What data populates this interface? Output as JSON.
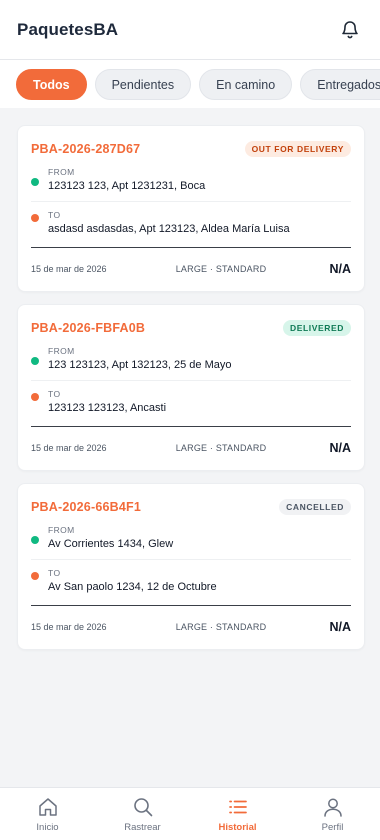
{
  "app": {
    "brand": "PaquetesBA"
  },
  "tabs": [
    {
      "label": "Todos",
      "active": true
    },
    {
      "label": "Pendientes",
      "active": false
    },
    {
      "label": "En camino",
      "active": false
    },
    {
      "label": "Entregados",
      "active": false
    }
  ],
  "shipments": [
    {
      "tracking": "PBA-2026-287D67",
      "status": "OUT FOR DELIVERY",
      "from_label": "FROM",
      "from": "123123 123, Apt 1231231, Boca",
      "to_label": "TO",
      "to": "asdasd asdasdas, Apt 123123, Aldea María Luisa",
      "date": "15 de mar de 2026",
      "size": "LARGE · STANDARD",
      "price": "N/A"
    },
    {
      "tracking": "PBA-2026-FBFA0B",
      "status": "DELIVERED",
      "from_label": "FROM",
      "from": "123 123123, Apt 132123, 25 de Mayo",
      "to_label": "TO",
      "to": "123123 123123, Ancasti",
      "date": "15 de mar de 2026",
      "size": "LARGE · STANDARD",
      "price": "N/A"
    },
    {
      "tracking": "PBA-2026-66B4F1",
      "status": "CANCELLED",
      "from_label": "FROM",
      "from": "Av Corrientes 1434, Glew",
      "to_label": "TO",
      "to": "Av San paolo 1234, 12 de Octubre",
      "date": "15 de mar de 2026",
      "size": "LARGE · STANDARD",
      "price": "N/A"
    }
  ],
  "nav": {
    "inicio": "Inicio",
    "rastrear": "Rastrear",
    "historial": "Historial",
    "perfil": "Perfil"
  },
  "colors": {
    "accent": "#f26b3a",
    "from_dot": "#10b981",
    "to_dot": "#f26b3a"
  },
  "icons": {
    "header": "bell-icon",
    "nav": [
      "home-icon",
      "search-icon",
      "list-icon",
      "user-icon"
    ]
  }
}
